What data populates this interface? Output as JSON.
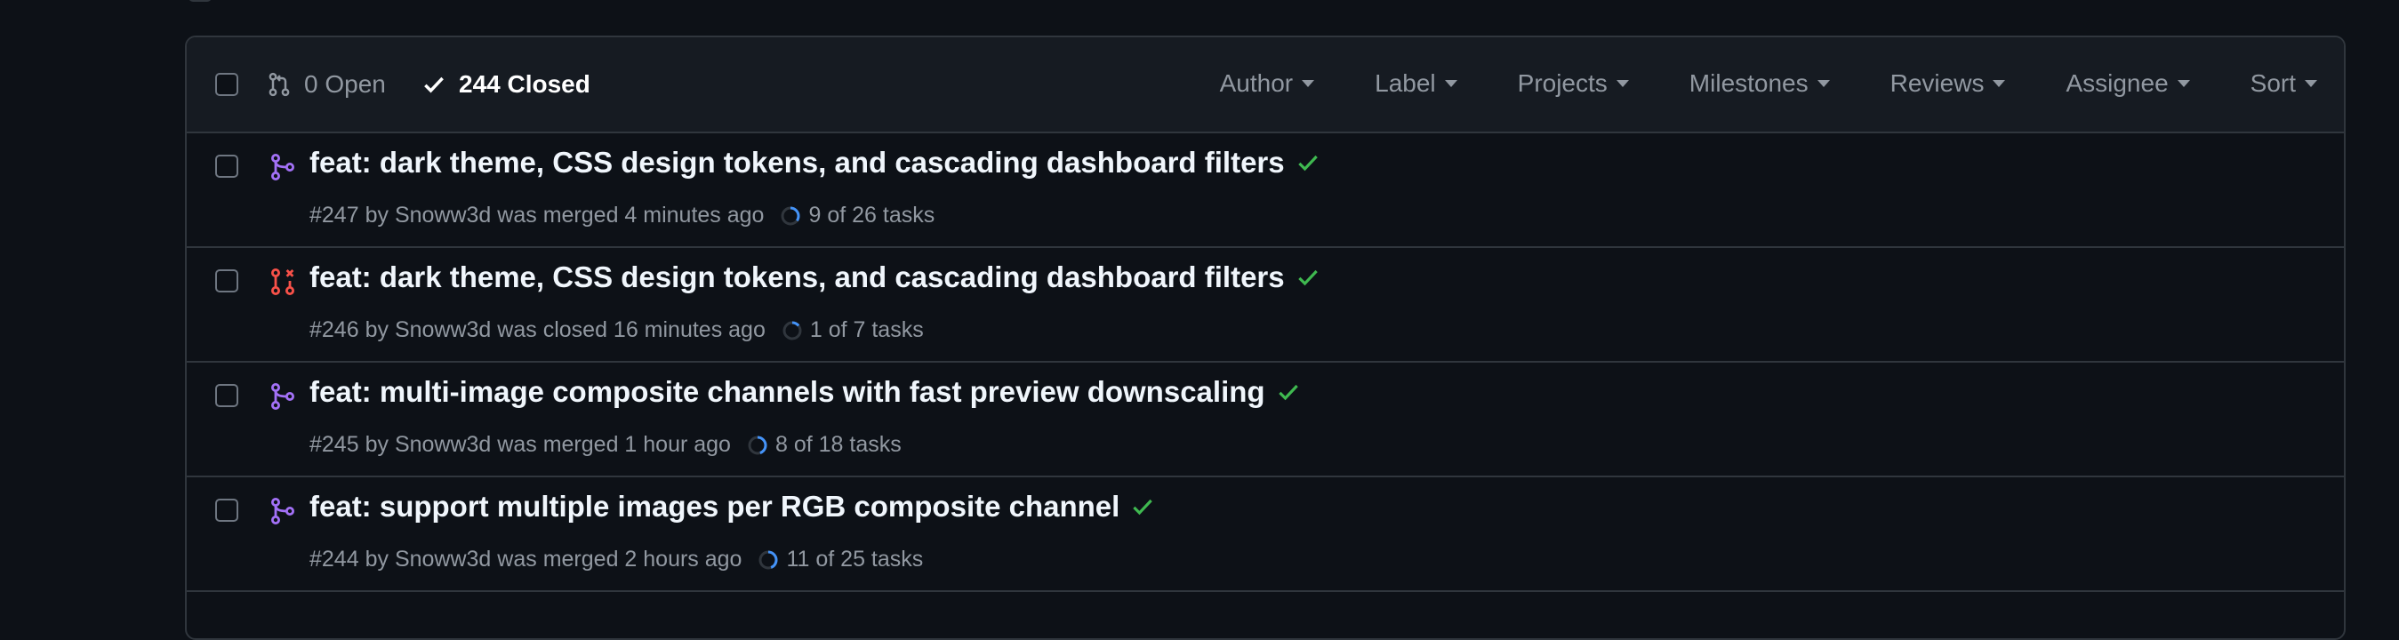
{
  "colors": {
    "background": "#0d1117",
    "header_background": "#161b22",
    "border": "#30363d",
    "merged_icon": "#a371f7",
    "closed_icon": "#f85149",
    "check_green": "#3fb950",
    "progress_blue": "#4493f8",
    "muted_text": "#9198a1"
  },
  "header": {
    "open_label": "0 Open",
    "closed_label": "244 Closed",
    "open_icon": "git-pull-request-icon",
    "closed_icon": "check-icon",
    "filters": [
      "Author",
      "Label",
      "Projects",
      "Milestones",
      "Reviews",
      "Assignee",
      "Sort"
    ]
  },
  "pull_requests": [
    {
      "title": "feat: dark theme, CSS design tokens, and cascading dashboard filters",
      "number": "#247",
      "by_text": "by",
      "author": "Snoww3d",
      "status_text": "was merged 4 minutes ago",
      "state": "merged",
      "state_icon": "git-merge-icon",
      "tasks_label": "9 of 26 tasks",
      "tasks_done": 9,
      "tasks_total": 26
    },
    {
      "title": "feat: dark theme, CSS design tokens, and cascading dashboard filters",
      "number": "#246",
      "by_text": "by",
      "author": "Snoww3d",
      "status_text": "was closed 16 minutes ago",
      "state": "closed",
      "state_icon": "git-pull-request-closed-icon",
      "tasks_label": "1 of 7 tasks",
      "tasks_done": 1,
      "tasks_total": 7
    },
    {
      "title": "feat: multi-image composite channels with fast preview downscaling",
      "number": "#245",
      "by_text": "by",
      "author": "Snoww3d",
      "status_text": "was merged 1 hour ago",
      "state": "merged",
      "state_icon": "git-merge-icon",
      "tasks_label": "8 of 18 tasks",
      "tasks_done": 8,
      "tasks_total": 18
    },
    {
      "title": "feat: support multiple images per RGB composite channel",
      "number": "#244",
      "by_text": "by",
      "author": "Snoww3d",
      "status_text": "was merged 2 hours ago",
      "state": "merged",
      "state_icon": "git-merge-icon",
      "tasks_label": "11 of 25 tasks",
      "tasks_done": 11,
      "tasks_total": 25
    }
  ]
}
